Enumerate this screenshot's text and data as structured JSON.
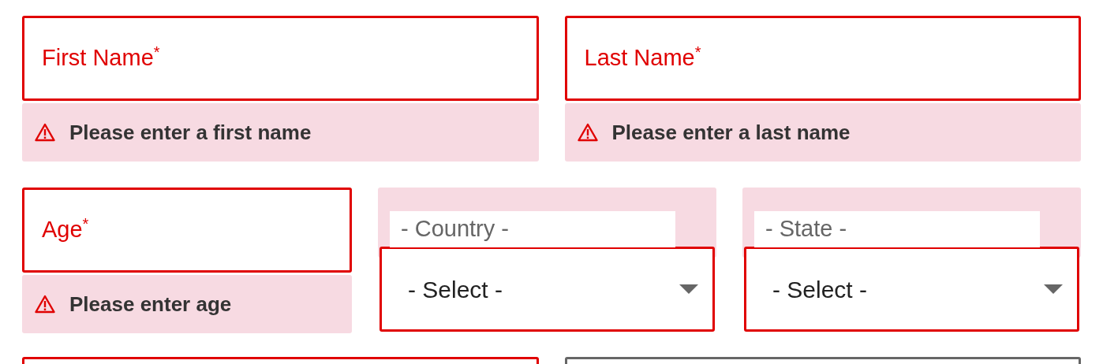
{
  "name_fields": [
    {
      "label": "First Name",
      "required_mark": "*",
      "error": "Please enter a first name"
    },
    {
      "label": "Last Name",
      "required_mark": "*",
      "error": "Please enter a last name"
    }
  ],
  "age_field": {
    "label": "Age",
    "required_mark": "*",
    "error": "Please enter age"
  },
  "selects": [
    {
      "label": "- Country -",
      "value": "- Select -",
      "invalid": true
    },
    {
      "label": "- State -",
      "value": "- Select -",
      "invalid": true
    }
  ],
  "next_fields": [
    {
      "invalid": true
    },
    {
      "invalid": false
    }
  ]
}
